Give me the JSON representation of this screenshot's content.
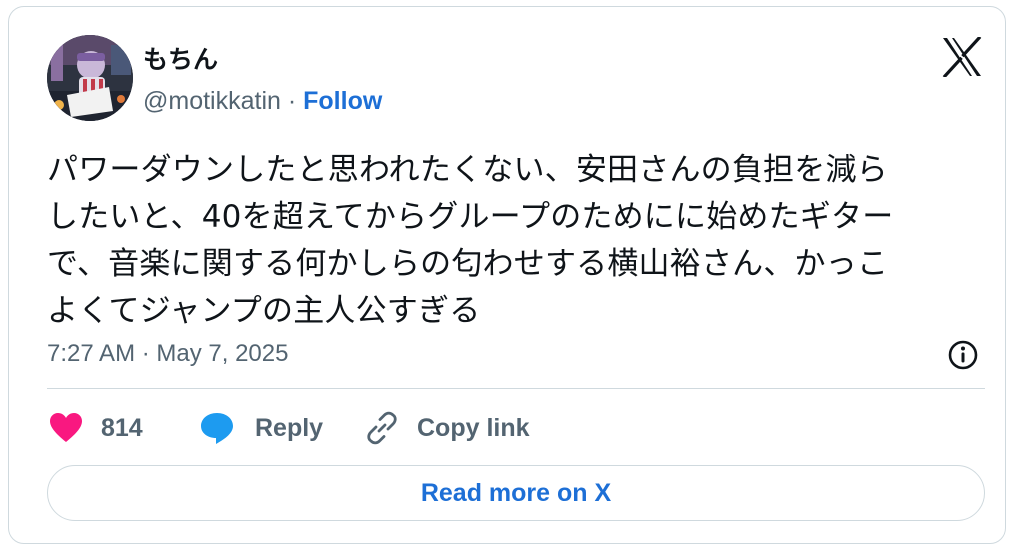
{
  "author": {
    "display_name": "もちん",
    "handle": "@motikkatin",
    "separator": " · ",
    "follow_label": "Follow"
  },
  "tweet": {
    "text": "パワーダウンしたと思われたくない、安田さんの負担を減ら\nしたいと、40を超えてからグループのためにに始めたギター\nで、音楽に関する何かしらの匂わせする横山裕さん、かっこ\nよくてジャンプの主人公すぎる",
    "timestamp": "7:27 AM · May 7, 2025"
  },
  "actions": {
    "like_count": "814",
    "reply_label": "Reply",
    "copy_link_label": "Copy link"
  },
  "read_more_label": "Read more on X",
  "colors": {
    "like": "#f91880",
    "reply": "#1d9bf0",
    "link": "#1d6fd6",
    "muted": "#536471",
    "border": "#cfd9de"
  },
  "icons": [
    "x-logo-icon",
    "info-icon",
    "heart-icon",
    "speech-bubble-icon",
    "link-icon"
  ]
}
